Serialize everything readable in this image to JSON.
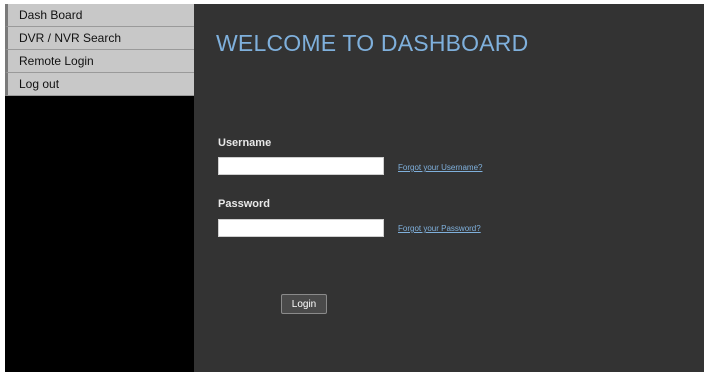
{
  "sidebar": {
    "items": [
      {
        "label": "Dash Board"
      },
      {
        "label": "DVR / NVR Search"
      },
      {
        "label": "Remote Login"
      },
      {
        "label": "Log out"
      }
    ]
  },
  "main": {
    "title": "WELCOME TO DASHBOARD",
    "username_label": "Username",
    "username_value": "",
    "forgot_username": "Forgot your Username?",
    "password_label": "Password",
    "password_value": "",
    "forgot_password": "Forgot your Password?",
    "login_button": "Login"
  },
  "colors": {
    "panel_background": "#333333",
    "sidebar_background": "#000000",
    "nav_item_background": "#c8c8c8",
    "title_color": "#7fb0dc",
    "link_color": "#7fb0dc"
  }
}
